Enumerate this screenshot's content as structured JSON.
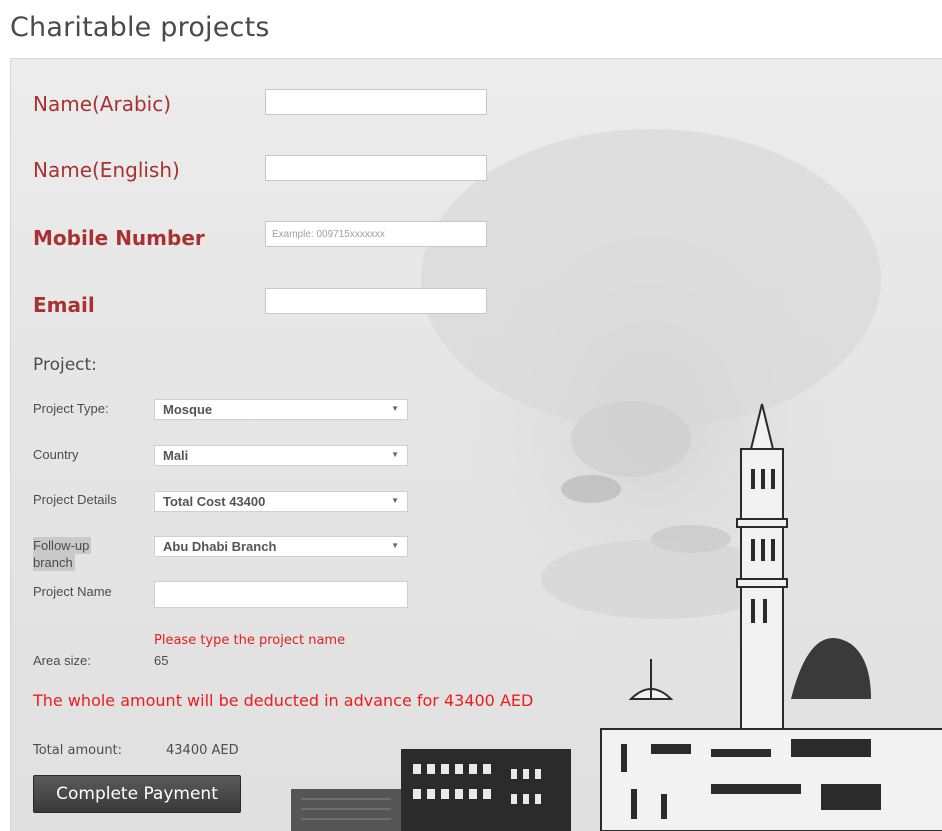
{
  "page": {
    "title": "Charitable projects"
  },
  "form": {
    "name_arabic": {
      "label": "Name(Arabic)",
      "value": ""
    },
    "name_english": {
      "label": "Name(English)",
      "value": ""
    },
    "mobile": {
      "label": "Mobile Number",
      "value": "",
      "placeholder": "Example: 009715xxxxxxx"
    },
    "email": {
      "label": "Email",
      "value": ""
    }
  },
  "project": {
    "heading": "Project:",
    "type": {
      "label": "Project Type:",
      "selected": "Mosque"
    },
    "country": {
      "label": "Country",
      "selected": "Mali"
    },
    "details": {
      "label": "Project Details",
      "selected": "Total Cost 43400"
    },
    "branch": {
      "label_line1": "Follow-up",
      "label_line2": "branch",
      "selected": "Abu Dhabi Branch"
    },
    "name": {
      "label": "Project Name",
      "value": ""
    },
    "name_warning": "Please type the project name",
    "area": {
      "label": "Area size:",
      "value": "65"
    }
  },
  "payment": {
    "notice": "The whole amount will be deducted in advance for 43400 AED",
    "total_label": "Total amount:",
    "total_value": "43400 AED",
    "button_label": "Complete Payment"
  },
  "icons": {
    "dropdown": "triangle-down-icon"
  },
  "colors": {
    "label_red": "#a83232",
    "warning_red": "#ee1c1c",
    "button_dark": "#3a3a3a"
  }
}
